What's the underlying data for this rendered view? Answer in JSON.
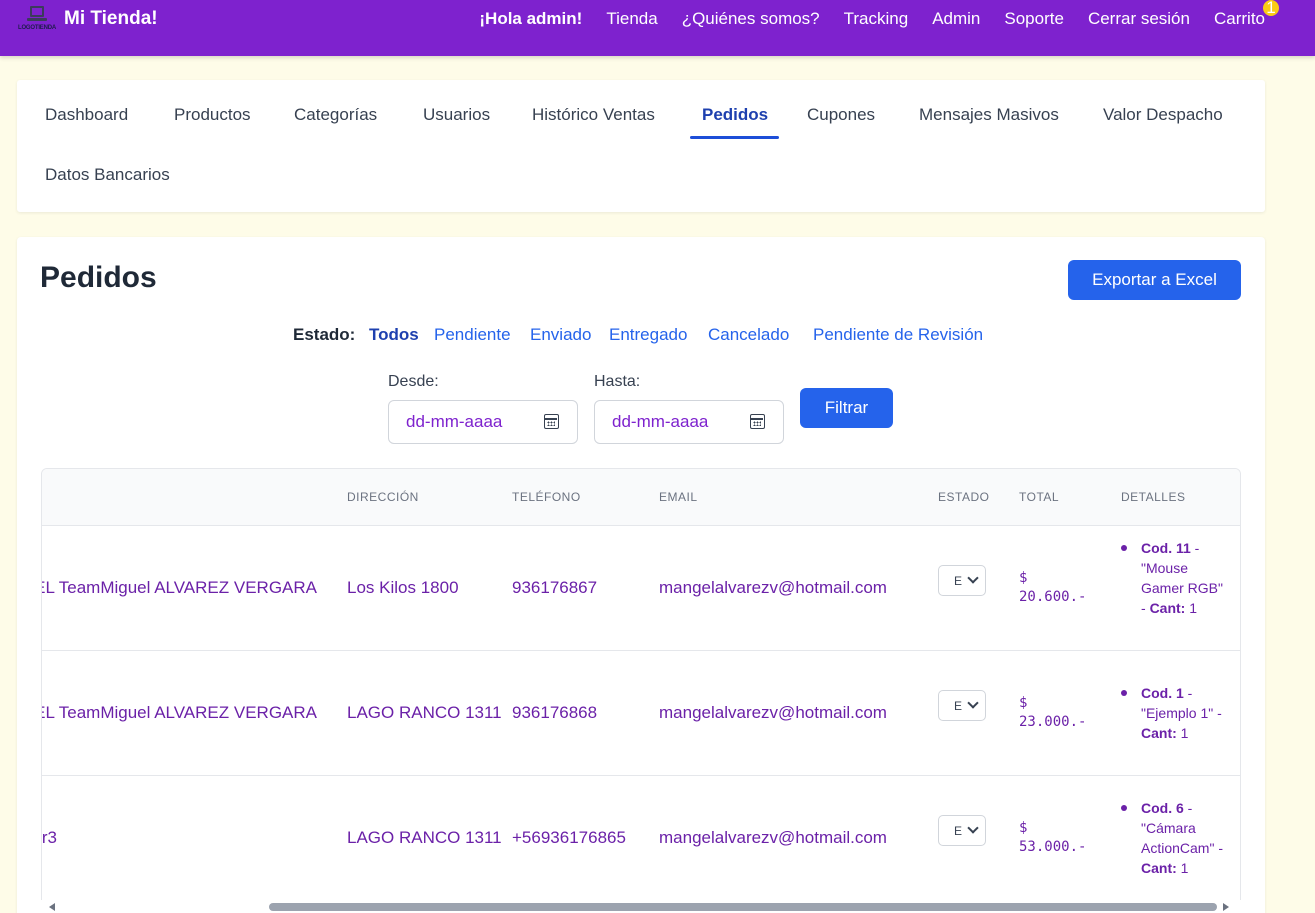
{
  "navbar": {
    "logo_text": "LOGOTIENDA",
    "brand": "Mi Tienda!",
    "links": [
      "¡Hola admin!",
      "Tienda",
      "¿Quiénes somos?",
      "Tracking",
      "Admin",
      "Soporte",
      "Cerrar sesión",
      "Carrito"
    ],
    "cart_count": "1",
    "color": "#7e22ce"
  },
  "tabs": [
    "Dashboard",
    "Productos",
    "Categorías",
    "Usuarios",
    "Histórico Ventas",
    "Pedidos",
    "Cupones",
    "Mensajes Masivos",
    "Valor Despacho",
    "Datos Bancarios"
  ],
  "active_tab": "Pedidos",
  "page": {
    "title": "Pedidos",
    "export_button": "Exportar a Excel"
  },
  "filters": {
    "estado_label": "Estado:",
    "options": [
      "Todos",
      "Pendiente",
      "Enviado",
      "Entregado",
      "Cancelado",
      "Pendiente de Revisión"
    ],
    "active": "Todos",
    "desde_label": "Desde:",
    "hasta_label": "Hasta:",
    "date_placeholder": "dd-mm-aaaa",
    "filter_button": "Filtrar"
  },
  "table": {
    "headers": [
      "DIRECCIÓN",
      "TELÉFONO",
      "EMAIL",
      "ESTADO",
      "TOTAL",
      "DETALLES"
    ],
    "rows": [
      {
        "name": "GEL TeamMiguel ALVAREZ VERGARA",
        "address": "Los Kilos 1800",
        "phone": "936176867",
        "email": "mangelalvarezv@hotmail.com",
        "estado": "E",
        "total": "$\n20.600.-",
        "detail_code": "Cod. 11",
        "detail_text": " - \"Mouse Gamer RGB\" - ",
        "detail_qty_label": "Cant:",
        "detail_qty": " 1"
      },
      {
        "name": "GEL TeamMiguel ALVAREZ VERGARA",
        "address": "LAGO RANCO 1311",
        "phone": "936176868",
        "email": "mangelalvarezv@hotmail.com",
        "estado": "E",
        "total": "$\n23.000.-",
        "detail_code": "Cod. 1",
        "detail_text": " - \"Ejemplo 1\" - ",
        "detail_qty_label": "Cant:",
        "detail_qty": " 1"
      },
      {
        "name": "r3",
        "address": "LAGO RANCO 1311",
        "phone": "+56936176865",
        "email": "mangelalvarezv@hotmail.com",
        "estado": "E",
        "total": "$\n53.000.-",
        "detail_code": "Cod. 6",
        "detail_text": " - \"Cámara ActionCam\" - ",
        "detail_qty_label": "Cant:",
        "detail_qty": " 1"
      }
    ]
  }
}
